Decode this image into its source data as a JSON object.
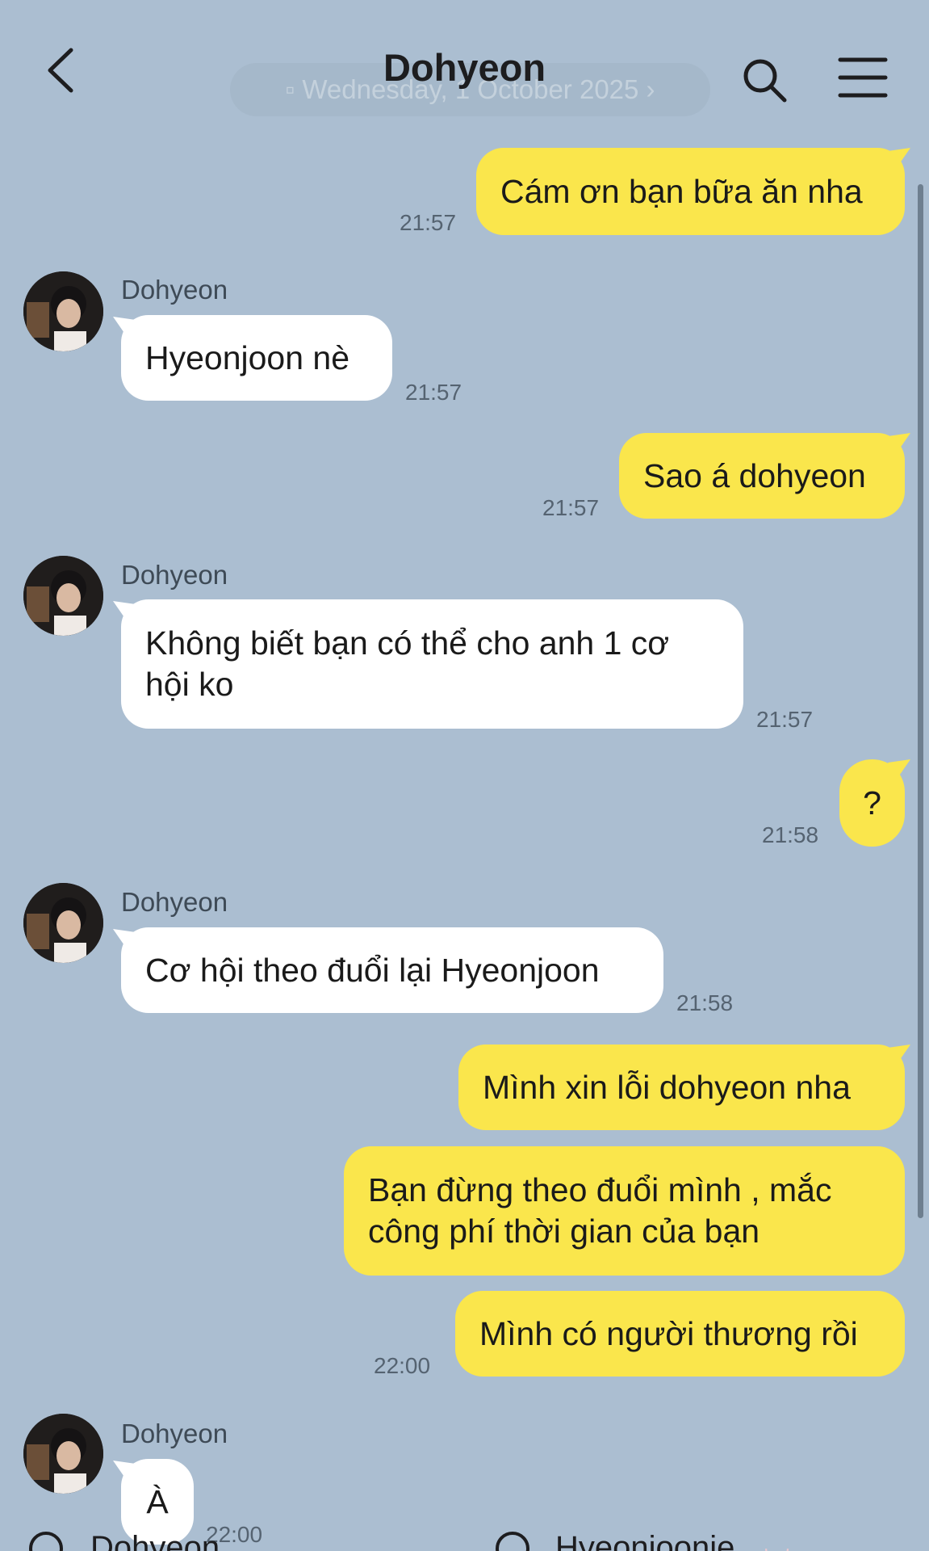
{
  "header": {
    "title": "Dohyeon",
    "date_pill": "Wednesday, 1 October 2025"
  },
  "messages": [
    {
      "dir": "out",
      "text": "Cám ơn bạn bữa ăn nha",
      "time": "21:57"
    },
    {
      "dir": "in",
      "sender": "Dohyeon",
      "text": "Hyeonjoon nè",
      "time": "21:57"
    },
    {
      "dir": "out",
      "text": "Sao á dohyeon",
      "time": "21:57"
    },
    {
      "dir": "in",
      "sender": "Dohyeon",
      "text": "Không biết bạn có thể cho anh 1 cơ hội ko",
      "time": "21:57"
    },
    {
      "dir": "out",
      "text": "?",
      "time": "21:58"
    },
    {
      "dir": "in",
      "sender": "Dohyeon",
      "text": "Cơ hội theo đuổi lại Hyeonjoon",
      "time": "21:58"
    },
    {
      "dir": "out",
      "text": "Mình xin lỗi dohyeon nha"
    },
    {
      "dir": "out",
      "text": "Bạn đừng theo đuổi mình , mắc công phí thời gian của bạn"
    },
    {
      "dir": "out",
      "text": "Mình có người thương rồi",
      "time": "22:00"
    },
    {
      "dir": "in",
      "sender": "Dohyeon",
      "text": "À",
      "time": "22:00"
    }
  ],
  "bottom": {
    "left_name": "Dohyeon",
    "right_name": "Hyeonjoonie"
  },
  "colors": {
    "background": "#abbed1",
    "outgoing_bubble": "#fae64c",
    "incoming_bubble": "#ffffff"
  },
  "icons": [
    "back-chevron-icon",
    "search-icon",
    "menu-icon",
    "calendar-icon",
    "chevron-right-icon"
  ]
}
